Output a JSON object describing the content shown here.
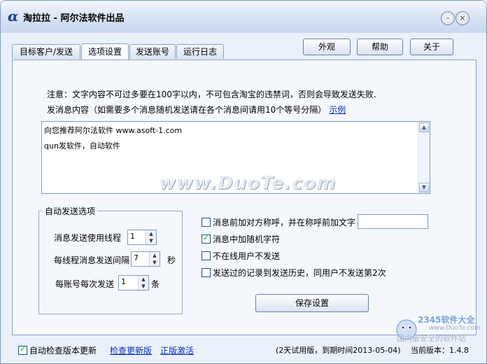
{
  "titlebar": {
    "logo_char": "α",
    "title": "淘拉拉 - 阿尔法软件出品",
    "min_glyph": "–",
    "close_glyph": "×"
  },
  "tabs": [
    "目标客户/发送",
    "选项设置",
    "发送账号",
    "运行日志"
  ],
  "top_buttons": {
    "appearance": "外观",
    "help": "帮助",
    "about": "关于"
  },
  "note": "注意：文字内容不可过多要在100字以内，不可包含淘宝的违禁词，否则会导致发送失败.",
  "message": {
    "label": "发消息内容（如需要多个消息随机发送请在各个消息间请用10个等号分隔）",
    "example_link": "示例",
    "line1": "向您推荐阿尔法软件 www.asoft-1.com",
    "line2": "qun发软件，自动软件"
  },
  "watermark": "www.DuoTe.com",
  "auto_send": {
    "title": "自动发送选项",
    "threads_label": "消息发送使用线程",
    "threads_value": "1",
    "interval_label": "每线程消息发送间隔",
    "interval_value": "7",
    "interval_unit": "秒",
    "per_account_label": "每账号每次发送",
    "per_account_value": "1",
    "per_account_unit": "条"
  },
  "options": [
    {
      "label": "消息前加对方称呼，并在称呼前加文字",
      "checked": false
    },
    {
      "label": "消息中加随机字符",
      "checked": true
    },
    {
      "label": "不在线用户不发送",
      "checked": false
    },
    {
      "label": "发送过的记录到发送历史，同用户不发送第2次",
      "checked": false
    }
  ],
  "save_button": "保存设置",
  "bottom": {
    "auto_update_label": "自动检查版本更新",
    "auto_update_checked": true,
    "check_update_link": "检查更新版",
    "activate_link": "正版激活",
    "trial_text": "(2天试用版，到期时间2013-05-04)",
    "version_text": "当前版本：1.4.8"
  },
  "badge": {
    "brand": "2345软件大全",
    "url": "www.DuoTe.com",
    "text": "国内最安全的软件站"
  },
  "colors": {
    "link": "#0a2fb8",
    "accent": "#1c3f8f",
    "check": "#21a121"
  }
}
